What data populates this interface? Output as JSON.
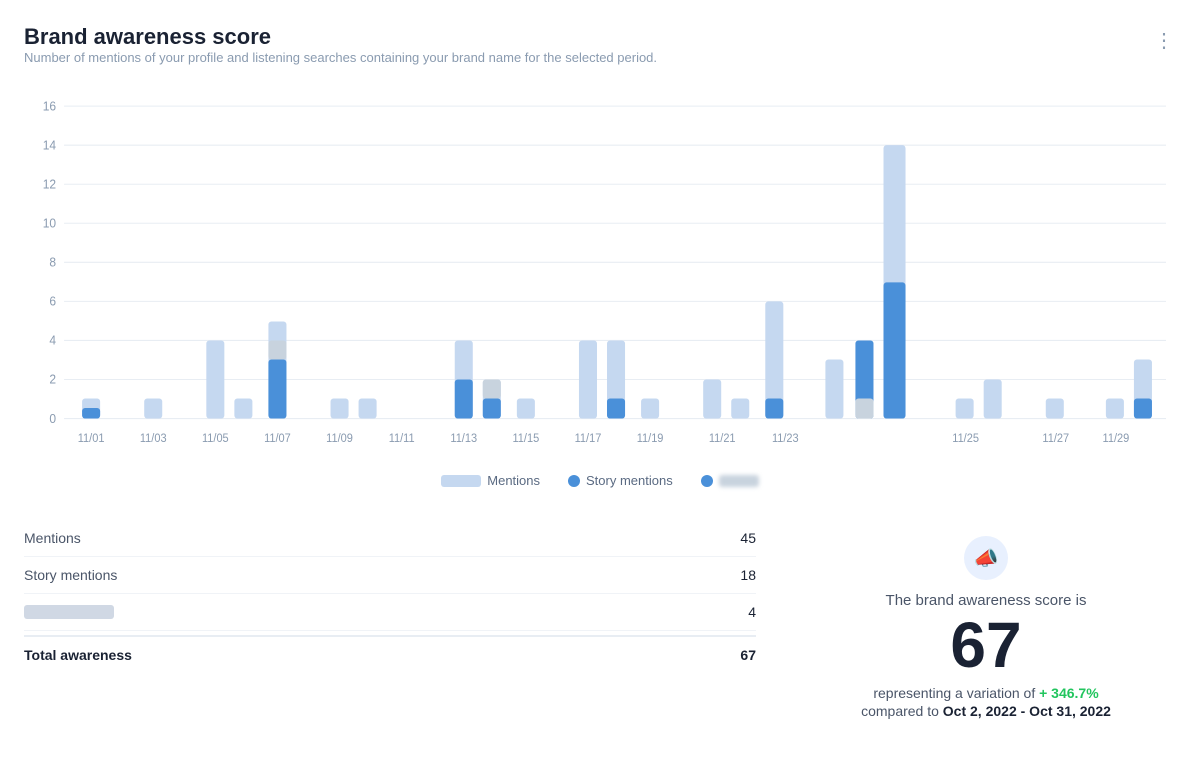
{
  "header": {
    "title": "Brand awareness score",
    "subtitle": "Number of mentions of your profile and listening searches containing your brand name for the selected period.",
    "more_icon": "⋮"
  },
  "chart": {
    "y_max": 16,
    "y_labels": [
      16,
      14,
      12,
      10,
      8,
      6,
      4,
      2,
      0
    ],
    "x_labels": [
      "11/01",
      "11/03",
      "11/05",
      "11/07",
      "11/09",
      "11/11",
      "11/13",
      "11/15",
      "11/17",
      "11/19",
      "11/21",
      "11/23",
      "11/25",
      "11/27",
      "11/29"
    ],
    "bars": [
      {
        "date": "11/01",
        "mentions": 1,
        "story": 0.5,
        "blurred": 0
      },
      {
        "date": "11/03",
        "mentions": 1,
        "story": 0,
        "blurred": 0
      },
      {
        "date": "11/05",
        "mentions": 4,
        "story": 0,
        "blurred": 0
      },
      {
        "date": "11/06",
        "mentions": 1,
        "story": 0,
        "blurred": 0
      },
      {
        "date": "11/07",
        "mentions": 5,
        "story": 3,
        "blurred": 1
      },
      {
        "date": "11/09",
        "mentions": 1,
        "story": 0,
        "blurred": 0
      },
      {
        "date": "11/10",
        "mentions": 1,
        "story": 0,
        "blurred": 0
      },
      {
        "date": "11/13",
        "mentions": 4,
        "story": 2,
        "blurred": 0
      },
      {
        "date": "11/14",
        "mentions": 2,
        "story": 1,
        "blurred": 1
      },
      {
        "date": "11/15",
        "mentions": 1,
        "story": 0,
        "blurred": 0
      },
      {
        "date": "11/16",
        "mentions": 4,
        "story": 0,
        "blurred": 0
      },
      {
        "date": "11/17",
        "mentions": 4,
        "story": 1,
        "blurred": 0
      },
      {
        "date": "11/18",
        "mentions": 1,
        "story": 0,
        "blurred": 0
      },
      {
        "date": "11/19",
        "mentions": 2,
        "story": 0,
        "blurred": 0
      },
      {
        "date": "11/20",
        "mentions": 1,
        "story": 0,
        "blurred": 0
      },
      {
        "date": "11/21",
        "mentions": 6,
        "story": 1,
        "blurred": 0
      },
      {
        "date": "11/22",
        "mentions": 3,
        "story": 0,
        "blurred": 0
      },
      {
        "date": "11/23",
        "mentions": 4,
        "story": 4,
        "blurred": 1
      },
      {
        "date": "11/24",
        "mentions": 14,
        "story": 7,
        "blurred": 0
      },
      {
        "date": "11/25",
        "mentions": 1,
        "story": 0,
        "blurred": 0
      },
      {
        "date": "11/26",
        "mentions": 2,
        "story": 0,
        "blurred": 0
      },
      {
        "date": "11/27",
        "mentions": 1,
        "story": 0,
        "blurred": 0
      },
      {
        "date": "11/29",
        "mentions": 1,
        "story": 0,
        "blurred": 0
      },
      {
        "date": "11/30",
        "mentions": 3,
        "story": 1,
        "blurred": 0
      }
    ]
  },
  "legend": {
    "mentions_label": "Mentions",
    "story_label": "Story mentions",
    "mentions_color": "#c5d8f0",
    "story_color": "#4a90d9",
    "blurred_color": "#c8d3de"
  },
  "summary": {
    "rows": [
      {
        "label": "Mentions",
        "value": "45",
        "blurred": false
      },
      {
        "label": "Story mentions",
        "value": "18",
        "blurred": false
      },
      {
        "label": null,
        "value": "4",
        "blurred": true
      },
      {
        "label": "Total awareness",
        "value": "67",
        "total": true
      }
    ]
  },
  "score_panel": {
    "icon": "📣",
    "label": "The brand awareness score is",
    "score": "67",
    "variation_prefix": "representing a variation of",
    "variation": "+ 346.7%",
    "compared_prefix": "compared to",
    "compared_date": "Oct 2, 2022 - Oct 31, 2022"
  }
}
